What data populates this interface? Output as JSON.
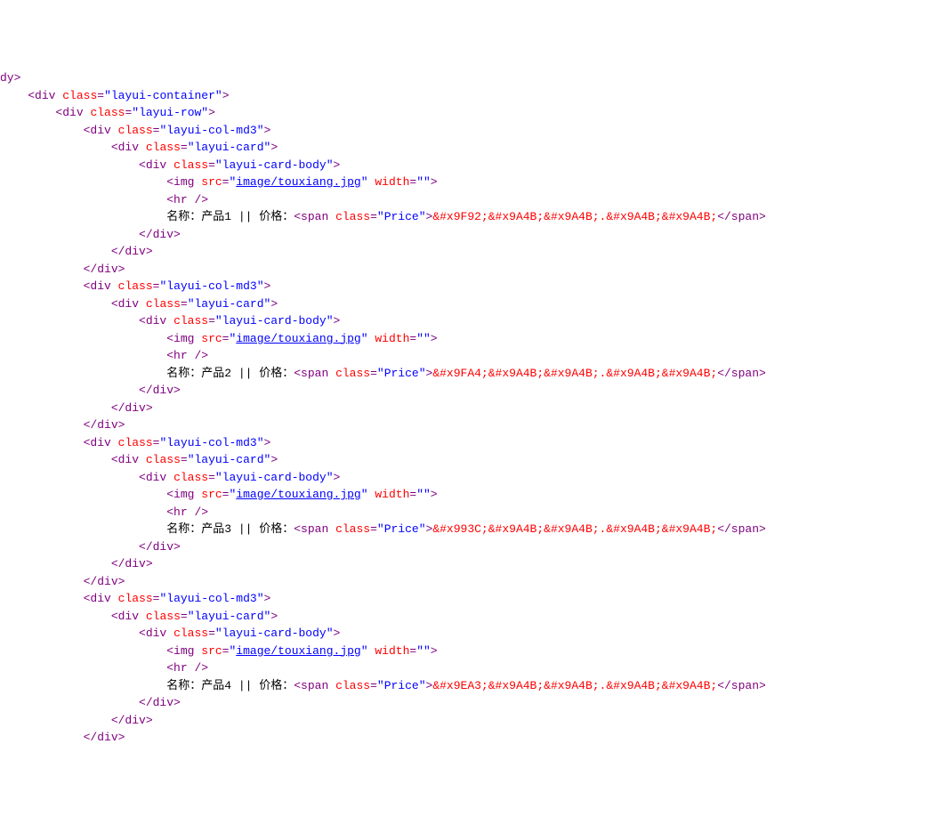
{
  "root_tag": "dy",
  "container_class": "layui-container",
  "row_class": "layui-row",
  "col_class": "layui-col-md3",
  "card_class": "layui-card",
  "body_class": "layui-card-body",
  "img_src": "image/touxiang.jpg",
  "img_width": "",
  "label_name": "名称：",
  "label_price": " || 价格：",
  "span_class": "Price",
  "items": [
    {
      "product_text": "产品1",
      "entity_seq": "&#x9F92;&#x9A4B;&#x9A4B;.&#x9A4B;&#x9A4B;"
    },
    {
      "product_text": "产品2",
      "entity_seq": "&#x9FA4;&#x9A4B;&#x9A4B;.&#x9A4B;&#x9A4B;"
    },
    {
      "product_text": "产品3",
      "entity_seq": "&#x993C;&#x9A4B;&#x9A4B;.&#x9A4B;&#x9A4B;"
    },
    {
      "product_text": "产品4",
      "entity_seq": "&#x9EA3;&#x9A4B;&#x9A4B;.&#x9A4B;&#x9A4B;"
    }
  ]
}
